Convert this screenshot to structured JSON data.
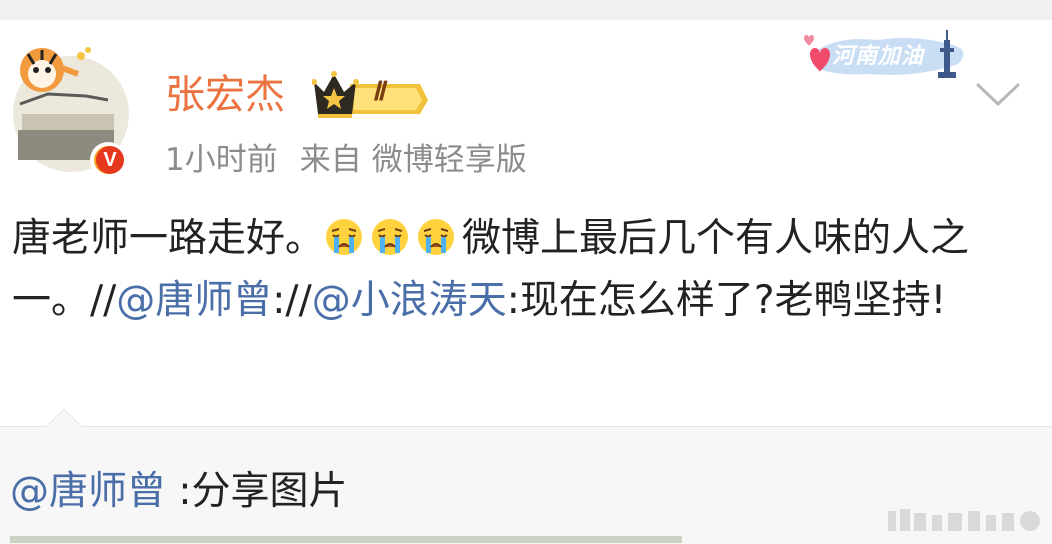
{
  "post": {
    "author": "张宏杰",
    "vip_level": "Ⅱ",
    "time": "1小时前",
    "source_prefix": "来自",
    "source": "微博轻享版",
    "badge_text": "河南加油",
    "text_part1": "唐老师一路走好。",
    "emoji_name": "crying-face-icon",
    "text_part2": "微博上最后几个有人味的人之一。//",
    "mention1": "@唐师曾",
    "text_part3": "://",
    "mention2": "@小浪涛天",
    "text_part4": ":现在怎么样了?老鸭坚持!"
  },
  "repost": {
    "mention": "@唐师曾",
    "text": " :分享图片"
  },
  "colors": {
    "username": "#eb7340",
    "mention": "#4a6ea8",
    "meta": "#8c8c8c",
    "repost_bg": "#f7f7f7"
  }
}
